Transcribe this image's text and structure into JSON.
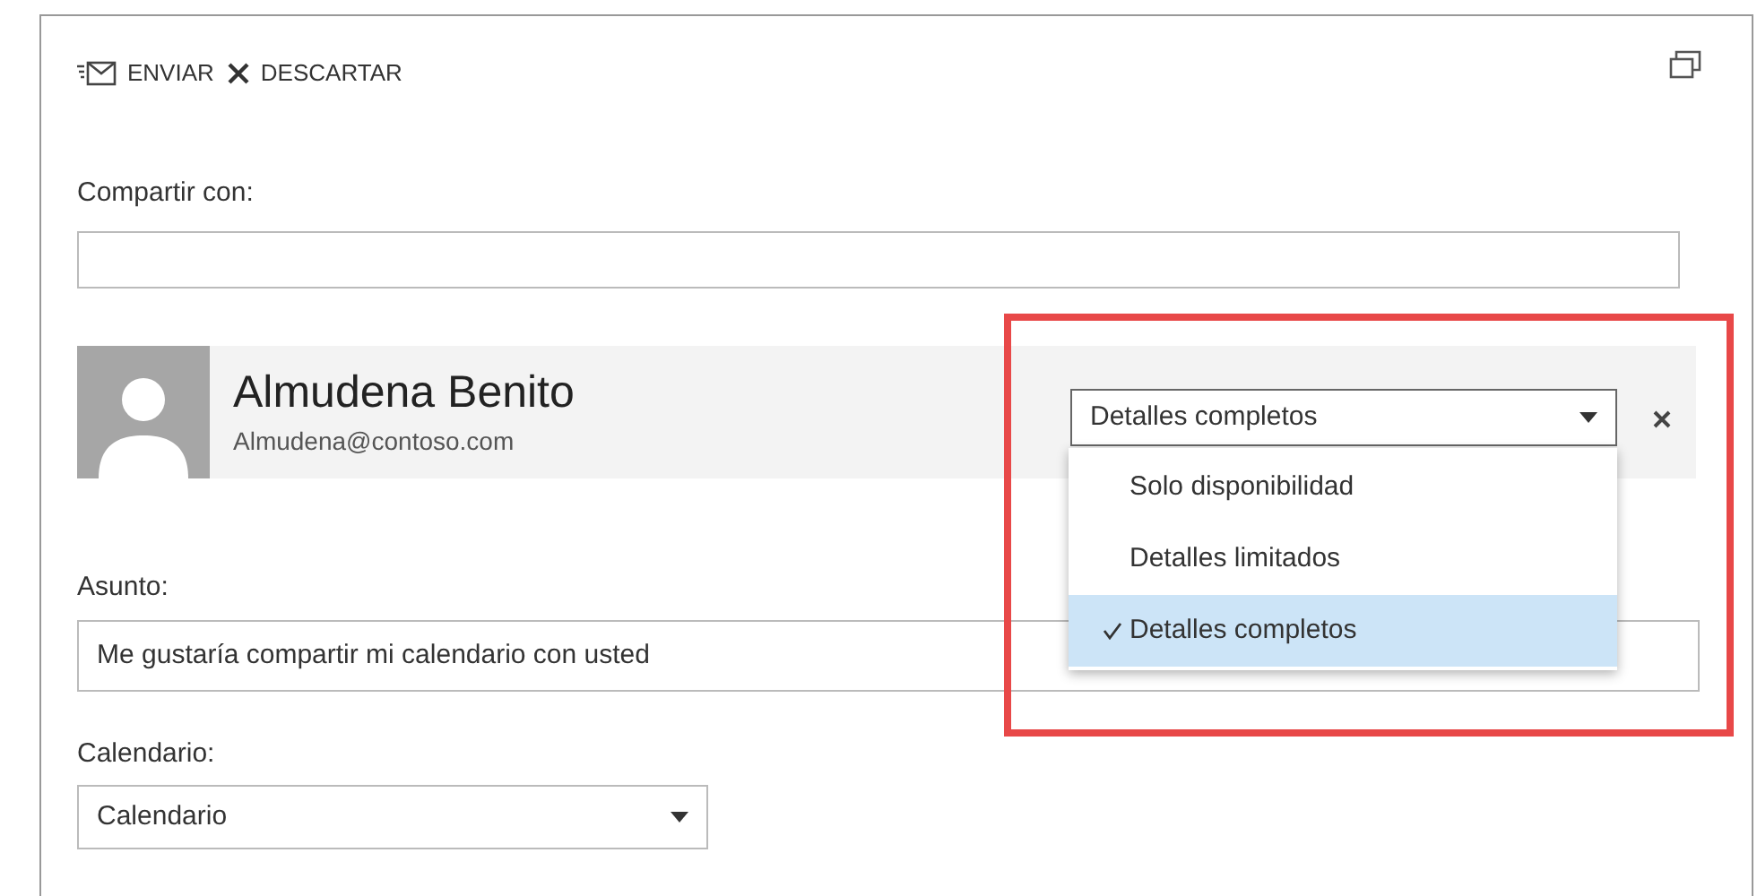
{
  "toolbar": [
    {
      "kind": "send",
      "label": "ENVIAR"
    },
    {
      "kind": "discard",
      "label": "DESCARTAR"
    }
  ],
  "share_with": {
    "label": "Compartir con:"
  },
  "recipient": {
    "name": "Almudena Benito",
    "email": "Almudena@contoso.com",
    "permission": {
      "value": "Detalles completos",
      "expanded": true,
      "options": [
        {
          "label": "Solo disponibilidad",
          "selected": false
        },
        {
          "label": "Detalles limitados",
          "selected": false
        },
        {
          "label": "Detalles completos",
          "selected": true
        }
      ]
    }
  },
  "subject": {
    "label": "Asunto:",
    "value": "Me gustaría compartir mi calendario con usted"
  },
  "calendar": {
    "label": "Calendario:",
    "value": "Calendario"
  }
}
